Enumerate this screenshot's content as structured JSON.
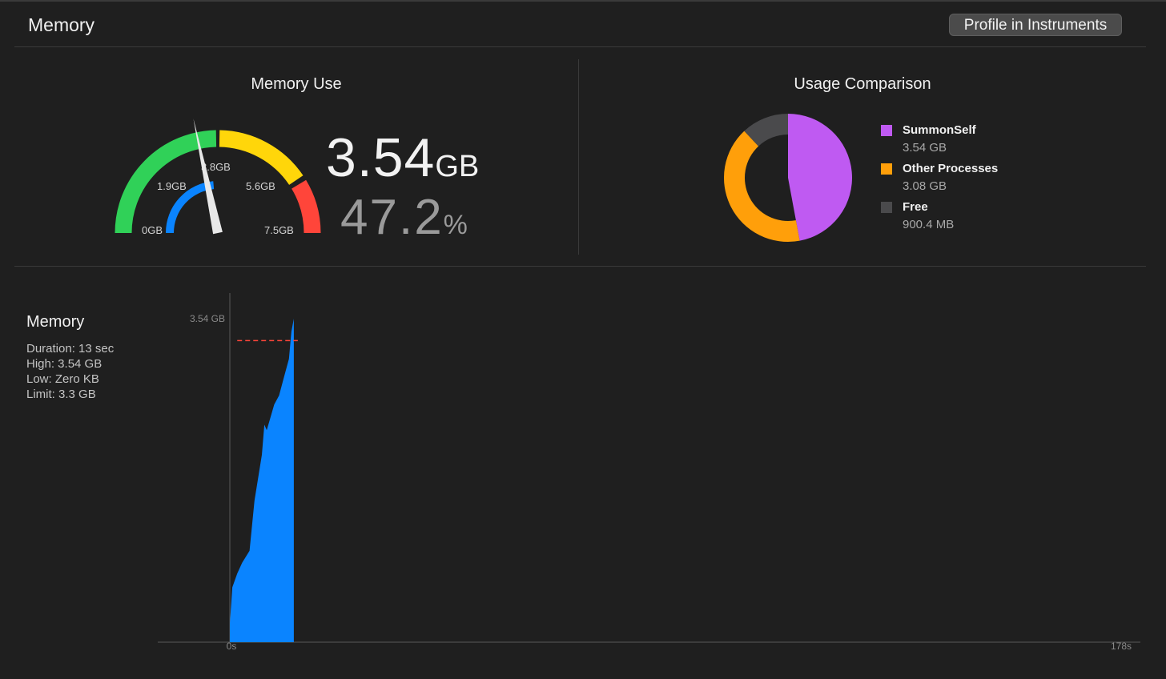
{
  "header": {
    "title": "Memory",
    "profile_button": "Profile in Instruments"
  },
  "memory_use": {
    "title": "Memory Use",
    "value": "3.54",
    "value_unit": "GB",
    "percent": "47.2",
    "percent_unit": "%",
    "gauge_min_gb": 0,
    "gauge_max_gb": 7.5,
    "gauge_value_gb": 3.54,
    "gauge_labels": [
      "0GB",
      "1.9GB",
      "3.8GB",
      "5.6GB",
      "7.5GB"
    ],
    "colors": {
      "green": "#30d158",
      "yellow": "#ffd60a",
      "red": "#ff453a",
      "blue": "#0a84ff",
      "needle": "#e8e8e8"
    }
  },
  "usage_comparison": {
    "title": "Usage Comparison",
    "items": [
      {
        "name": "SummonSelf",
        "value": "3.54 GB",
        "gb": 3.54,
        "color": "#bf5af2"
      },
      {
        "name": "Other Processes",
        "value": "3.08 GB",
        "gb": 3.08,
        "color": "#ff9f0a"
      },
      {
        "name": "Free",
        "value": "900.4 MB",
        "gb": 0.9004,
        "color": "#4a4a4c"
      }
    ]
  },
  "memory_graph": {
    "title": "Memory",
    "stats": [
      "Duration: 13 sec",
      "High: 3.54 GB",
      "Low: Zero KB",
      "Limit: 3.3 GB"
    ]
  },
  "chart_data": {
    "type": "area",
    "title": "",
    "xlabel": "",
    "ylabel": "",
    "x_unit": "s",
    "x_ticks": [
      "0s",
      "178s"
    ],
    "y_ticks": [
      "3.54 GB"
    ],
    "xlim": [
      0,
      178
    ],
    "ylim": [
      0,
      3.54
    ],
    "limit_gb": 3.3,
    "limit_color": "#ff453a",
    "fill_color": "#0a84ff",
    "series": [
      {
        "x": [
          0,
          0.5,
          1.5,
          2.5,
          4.0,
          5.0,
          6.5,
          7.0,
          7.5,
          9.0,
          10.0,
          11.0,
          12.0,
          12.5,
          13.0
        ],
        "y": [
          0.2,
          0.6,
          0.75,
          0.87,
          1.0,
          1.55,
          2.05,
          2.38,
          2.32,
          2.6,
          2.7,
          2.9,
          3.1,
          3.4,
          3.54
        ]
      }
    ]
  }
}
